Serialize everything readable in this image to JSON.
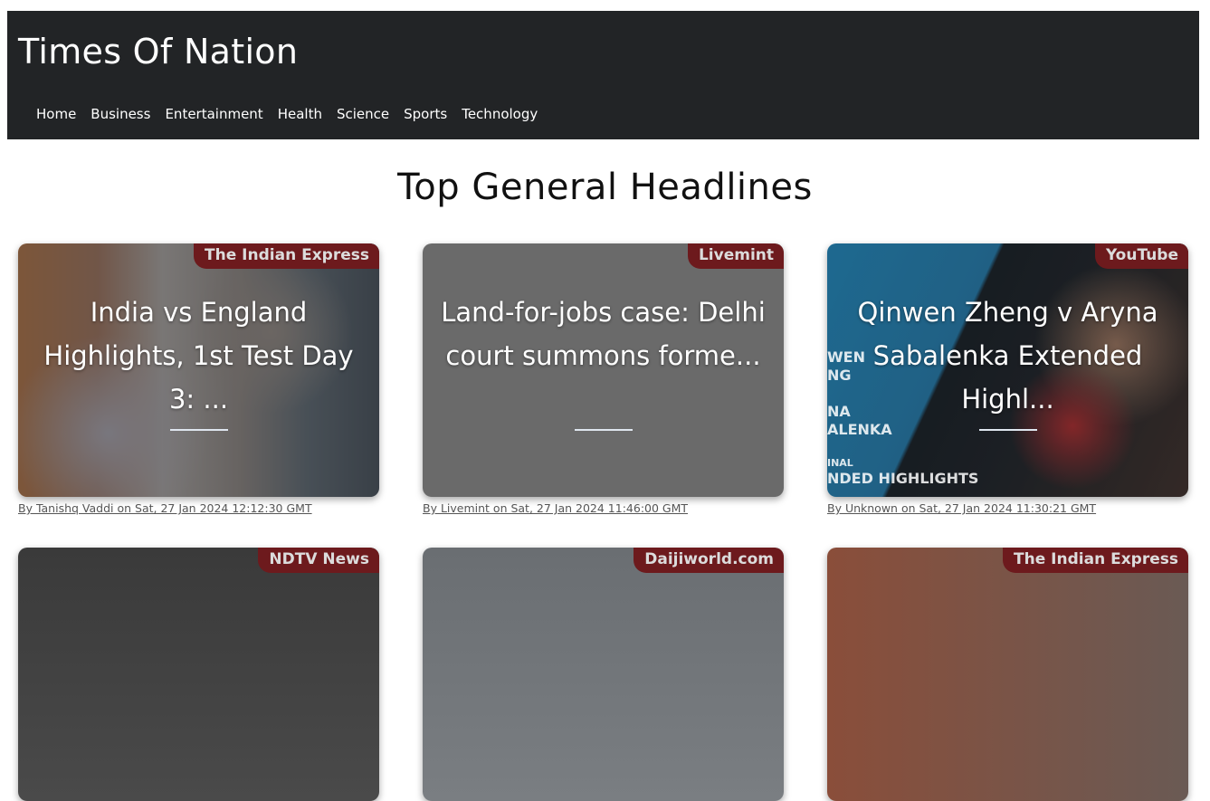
{
  "site": {
    "brand": "Times Of Nation",
    "nav": [
      "Home",
      "Business",
      "Entertainment",
      "Health",
      "Science",
      "Sports",
      "Technology"
    ]
  },
  "page_title": "Top General Headlines",
  "cards": [
    {
      "source": "The Indian Express",
      "title": "India vs England Highlights, 1st Test Day 3: ...",
      "byline": "By Tanishq Vaddi on Sat, 27 Jan 2024 12:12:30 GMT"
    },
    {
      "source": "Livemint",
      "title": "Land-for-jobs case: Delhi court summons forme...",
      "byline": "By Livemint on Sat, 27 Jan 2024 11:46:00 GMT"
    },
    {
      "source": "YouTube",
      "title": "Qinwen Zheng v Aryna Sabalenka Extended Highl...",
      "byline": "By Unknown on Sat, 27 Jan 2024 11:30:21 GMT",
      "image_text": [
        "WEN",
        "NG",
        "",
        "NA",
        "ALENKA",
        "",
        "INAL",
        "NDED HIGHLIGHTS"
      ]
    },
    {
      "source": "NDTV News"
    },
    {
      "source": "Daijiworld.com"
    },
    {
      "source": "The Indian Express"
    }
  ],
  "colors": {
    "navbar": "#222426",
    "badge": "#6d1a1d",
    "card_overlay": "#464646"
  }
}
